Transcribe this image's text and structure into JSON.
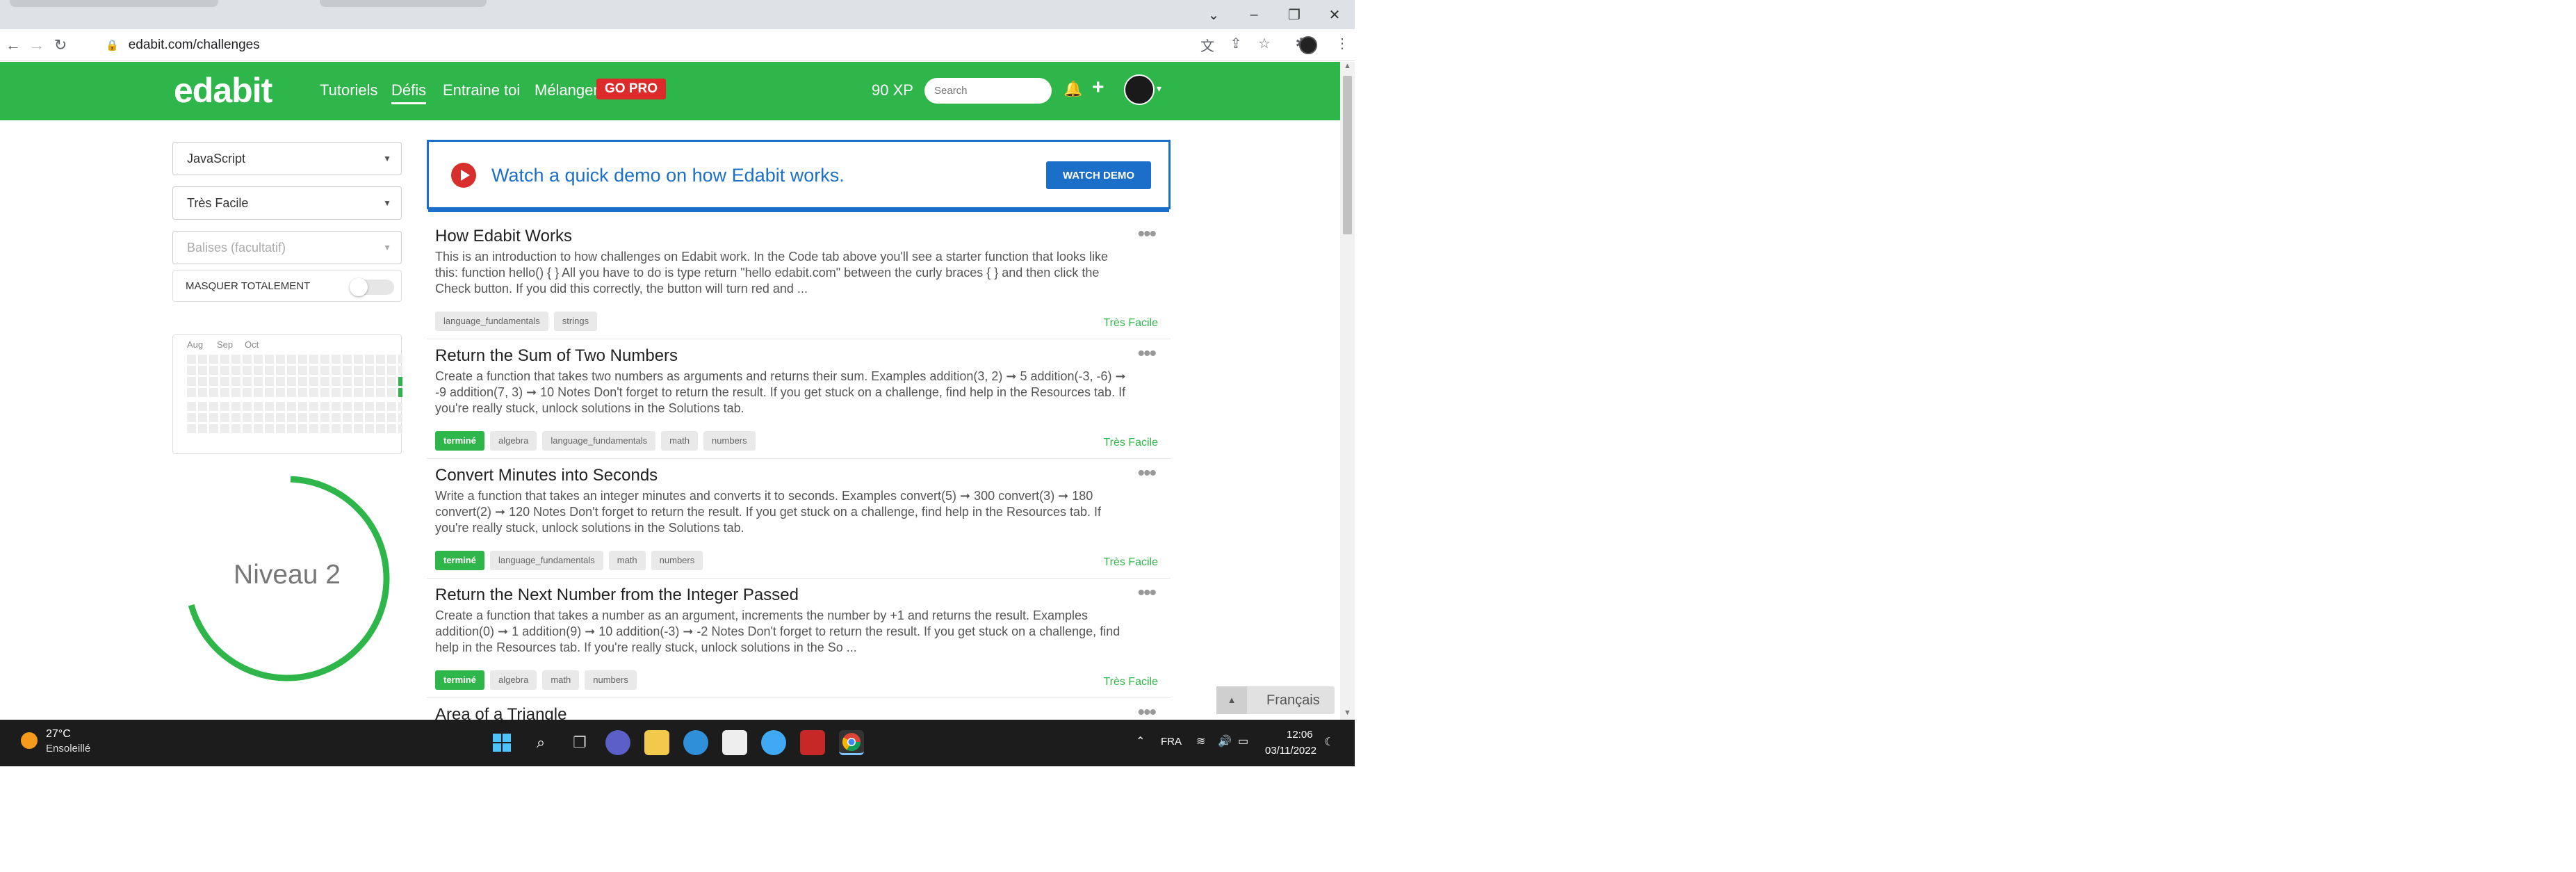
{
  "browser": {
    "url": "edabit.com/challenges",
    "window_controls": [
      "⌄",
      "–",
      "❐",
      "✕"
    ]
  },
  "site": {
    "logo": "edabit",
    "nav": [
      "Tutoriels",
      "Défis",
      "Entraine toi",
      "Mélanger"
    ],
    "gopro": "GO PRO",
    "xp": "90 XP",
    "search_placeholder": "Search",
    "brand_color": "#2fb64a"
  },
  "sidebar": {
    "language": "JavaScript",
    "difficulty": "Très Facile",
    "tags_placeholder": "Balises (facultatif)",
    "hide_label": "MASQUER TOTALEMENT",
    "hide_toggle_on": false,
    "heatmap_months": [
      "Aug",
      "Sep",
      "Oct"
    ],
    "level": "Niveau 2"
  },
  "demo": {
    "text": "Watch a quick demo on how Edabit works.",
    "button": "WATCH DEMO"
  },
  "challenges": [
    {
      "title": "How Edabit Works",
      "description": "This is an introduction to how challenges on Edabit work. In the Code tab above you'll see a starter function that looks like this: function hello() { } All you have to do is type return \"hello edabit.com\" between the curly braces { } and then click the Check button. If you did this correctly, the button will turn red and ...",
      "done": false,
      "tags": [
        "language_fundamentals",
        "strings"
      ],
      "difficulty": "Très Facile"
    },
    {
      "title": "Return the Sum of Two Numbers",
      "description": "Create a function that takes two numbers as arguments and returns their sum. Examples addition(3, 2) ➞ 5 addition(-3, -6) ➞ -9 addition(7, 3) ➞ 10 Notes Don't forget to return the result. If you get stuck on a challenge, find help in the Resources tab. If you're really stuck, unlock solutions in the Solutions tab.",
      "done": true,
      "tags": [
        "algebra",
        "language_fundamentals",
        "math",
        "numbers"
      ],
      "difficulty": "Très Facile"
    },
    {
      "title": "Convert Minutes into Seconds",
      "description": "Write a function that takes an integer minutes and converts it to seconds. Examples convert(5) ➞ 300 convert(3) ➞ 180 convert(2) ➞ 120 Notes Don't forget to return the result. If you get stuck on a challenge, find help in the Resources tab. If you're really stuck, unlock solutions in the Solutions tab.",
      "done": true,
      "tags": [
        "language_fundamentals",
        "math",
        "numbers"
      ],
      "difficulty": "Très Facile"
    },
    {
      "title": "Return the Next Number from the Integer Passed",
      "description": "Create a function that takes a number as an argument, increments the number by +1 and returns the result. Examples addition(0) ➞ 1 addition(9) ➞ 10 addition(-3) ➞ -2 Notes Don't forget to return the result. If you get stuck on a challenge, find help in the Resources tab. If you're really stuck, unlock solutions in the So ...",
      "done": true,
      "tags": [
        "algebra",
        "math",
        "numbers"
      ],
      "difficulty": "Très Facile"
    },
    {
      "title": "Area of a Triangle"
    }
  ],
  "done_label": "terminé",
  "language_switcher": "Français",
  "taskbar": {
    "temperature": "27°C",
    "weather": "Ensoleillé",
    "input_lang": "FRA",
    "time": "12:06",
    "date": "03/11/2022"
  }
}
